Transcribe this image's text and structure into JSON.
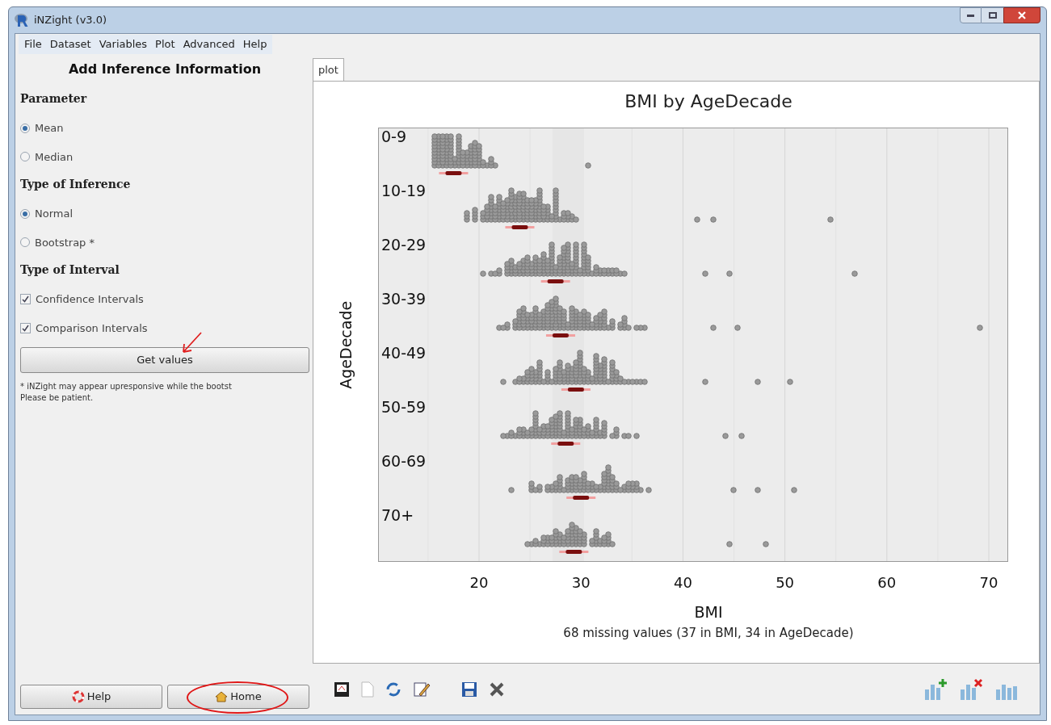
{
  "window": {
    "title": "iNZight (v3.0)"
  },
  "menu": [
    "File",
    "Dataset",
    "Variables",
    "Plot",
    "Advanced",
    "Help"
  ],
  "panel": {
    "title": "Add Inference Information",
    "sections": [
      {
        "heading": "Parameter",
        "kind": "radio",
        "options": [
          {
            "label": "Mean",
            "selected": true
          },
          {
            "label": "Median",
            "selected": false
          }
        ]
      },
      {
        "heading": "Type of Inference",
        "kind": "radio",
        "options": [
          {
            "label": "Normal",
            "selected": true
          },
          {
            "label": "Bootstrap *",
            "selected": false
          }
        ]
      },
      {
        "heading": "Type of Interval",
        "kind": "checkbox",
        "options": [
          {
            "label": "Confidence Intervals",
            "checked": true
          },
          {
            "label": "Comparison Intervals",
            "checked": true
          }
        ]
      }
    ],
    "button": "Get values",
    "note": [
      "* iNZight may appear upresponsive while the bootst",
      "Please be patient."
    ]
  },
  "tabs": [
    {
      "label": "plot",
      "selected": true
    }
  ],
  "plot": {
    "title": "BMI by AgeDecade",
    "xlabel": "BMI",
    "ylabel": "AgeDecade",
    "groups": [
      "0-9",
      "10-19",
      "20-29",
      "30-39",
      "40-49",
      "50-59",
      "60-69",
      "70+"
    ],
    "xticks": [
      "20",
      "30",
      "40",
      "50",
      "60",
      "70"
    ],
    "note": "68 missing values (37 in BMI, 34 in AgeDecade)"
  },
  "bottom_buttons": [
    "Help",
    "Home"
  ]
}
